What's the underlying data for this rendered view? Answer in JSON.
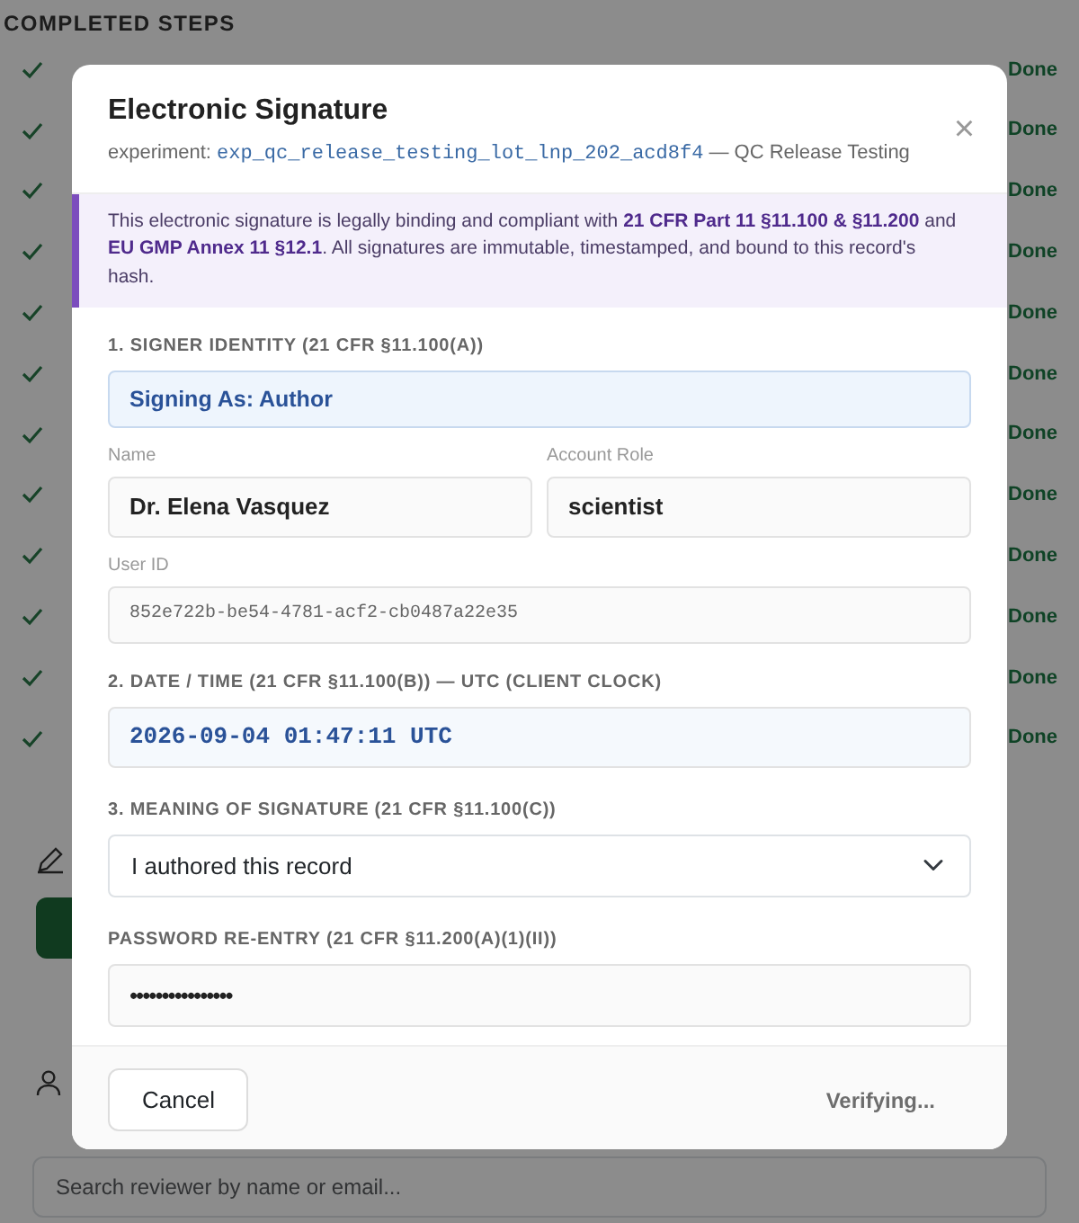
{
  "background": {
    "heading": "COMPLETED STEPS",
    "steps": [
      {
        "status": "Done"
      },
      {
        "status": "Done"
      },
      {
        "status": "Done"
      },
      {
        "status": "Done"
      },
      {
        "status": "Done"
      },
      {
        "status": "Done"
      },
      {
        "status": "Done"
      },
      {
        "status": "Done"
      },
      {
        "status": "Done"
      },
      {
        "status": "Done"
      },
      {
        "status": "Done"
      },
      {
        "status": "Done"
      }
    ],
    "reviewer_search": {
      "placeholder": "Search reviewer by name or email..."
    }
  },
  "modal": {
    "title": "Electronic Signature",
    "subtitle_prefix": "experiment:",
    "experiment_id": "exp_qc_release_testing_lot_lnp_202_acd8f4",
    "subtitle_suffix": "— QC Release Testing",
    "close": "×",
    "notice": "This electronic signature is legally binding and compliant with **21 CFR Part 11 §11.100 & §11.200** and **EU GMP Annex 11 §12.1**. All signatures are immutable, timestamped, and bound to this record's hash.",
    "identity_label": "1. SIGNER IDENTITY (21 CFR §11.100(A))",
    "signing_as": "Signing As: Author",
    "name_label": "Name",
    "name": "Dr. Elena Vasquez",
    "role_label": "Account Role",
    "role": "scientist",
    "user_id_label": "User ID",
    "user_id": "852e722b-be54-4781-acf2-cb0487a22e35",
    "datetime_label": "2. DATE / TIME (21 CFR §11.100(B)) — UTC (CLIENT CLOCK)",
    "datetime": "2026-09-04 01:47:11 UTC",
    "meaning_label": "3. MEANING OF SIGNATURE (21 CFR §11.100(C))",
    "meaning": "I authored this record",
    "password_label": "PASSWORD RE-ENTRY (21 CFR §11.200(A)(1)(II))",
    "password": "••••••••••••••••",
    "cancel": "Cancel",
    "submit": {
      "label": "Verifying...",
      "disabled": true
    }
  }
}
